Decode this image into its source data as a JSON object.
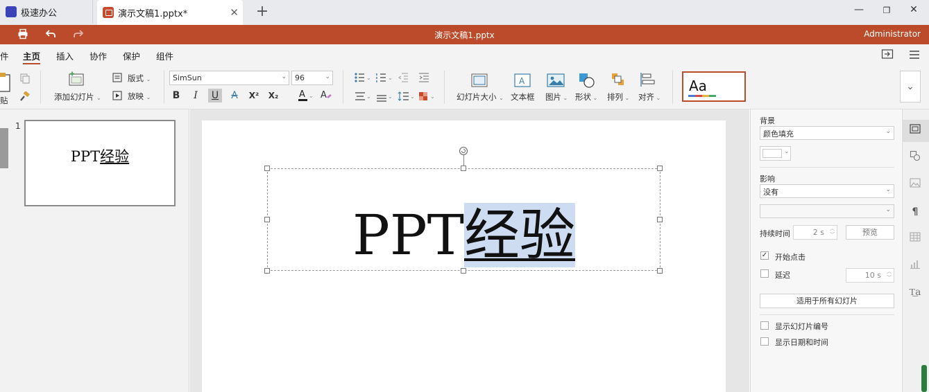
{
  "tabs": [
    {
      "label": "极速办公"
    },
    {
      "label": "演示文稿1.pptx*"
    }
  ],
  "window": {
    "title": "演示文稿1.pptx",
    "user": "Administrator"
  },
  "menu": {
    "cut_label": "件",
    "items": [
      {
        "label": "主页",
        "active": true
      },
      {
        "label": "插入"
      },
      {
        "label": "协作"
      },
      {
        "label": "保护"
      },
      {
        "label": "组件"
      }
    ]
  },
  "toolbar": {
    "paste_label": "贴",
    "add_slide_label": "添加幻灯片",
    "layout_label": "版式",
    "play_label": "放映",
    "font_name": "SimSun",
    "font_size": "96",
    "slide_size_label": "幻灯片大小",
    "textbox_label": "文本框",
    "image_label": "图片",
    "shape_label": "形状",
    "arrange_label": "排列",
    "align_label": "对齐",
    "theme_preview": "Aa",
    "format": {
      "bold": "B",
      "italic": "I",
      "underline": "U",
      "strike": "A",
      "superscript": "X²",
      "subscript": "X₂"
    }
  },
  "slides_panel": {
    "slide_number": "1",
    "thumb_text_a": "PPT",
    "thumb_text_b": "经验"
  },
  "slide": {
    "text_plain": "PPT",
    "text_selected": "经验"
  },
  "right_panel": {
    "background_label": "背景",
    "background_fill": "颜色填充",
    "effect_label": "影响",
    "effect_value": "没有",
    "duration_label": "持续时间",
    "duration_value": "2 s",
    "preview_button": "预览",
    "start_on_click": "开始点击",
    "start_on_click_checked": true,
    "delay_label": "延迟",
    "delay_checked": false,
    "delay_value": "10 s",
    "apply_all_button": "适用于所有幻灯片",
    "show_slide_number": "显示幻灯片编号",
    "show_date_time": "显示日期和时间"
  },
  "colors": {
    "accent": "#bc4b2b",
    "selection": "#cddcf1"
  }
}
